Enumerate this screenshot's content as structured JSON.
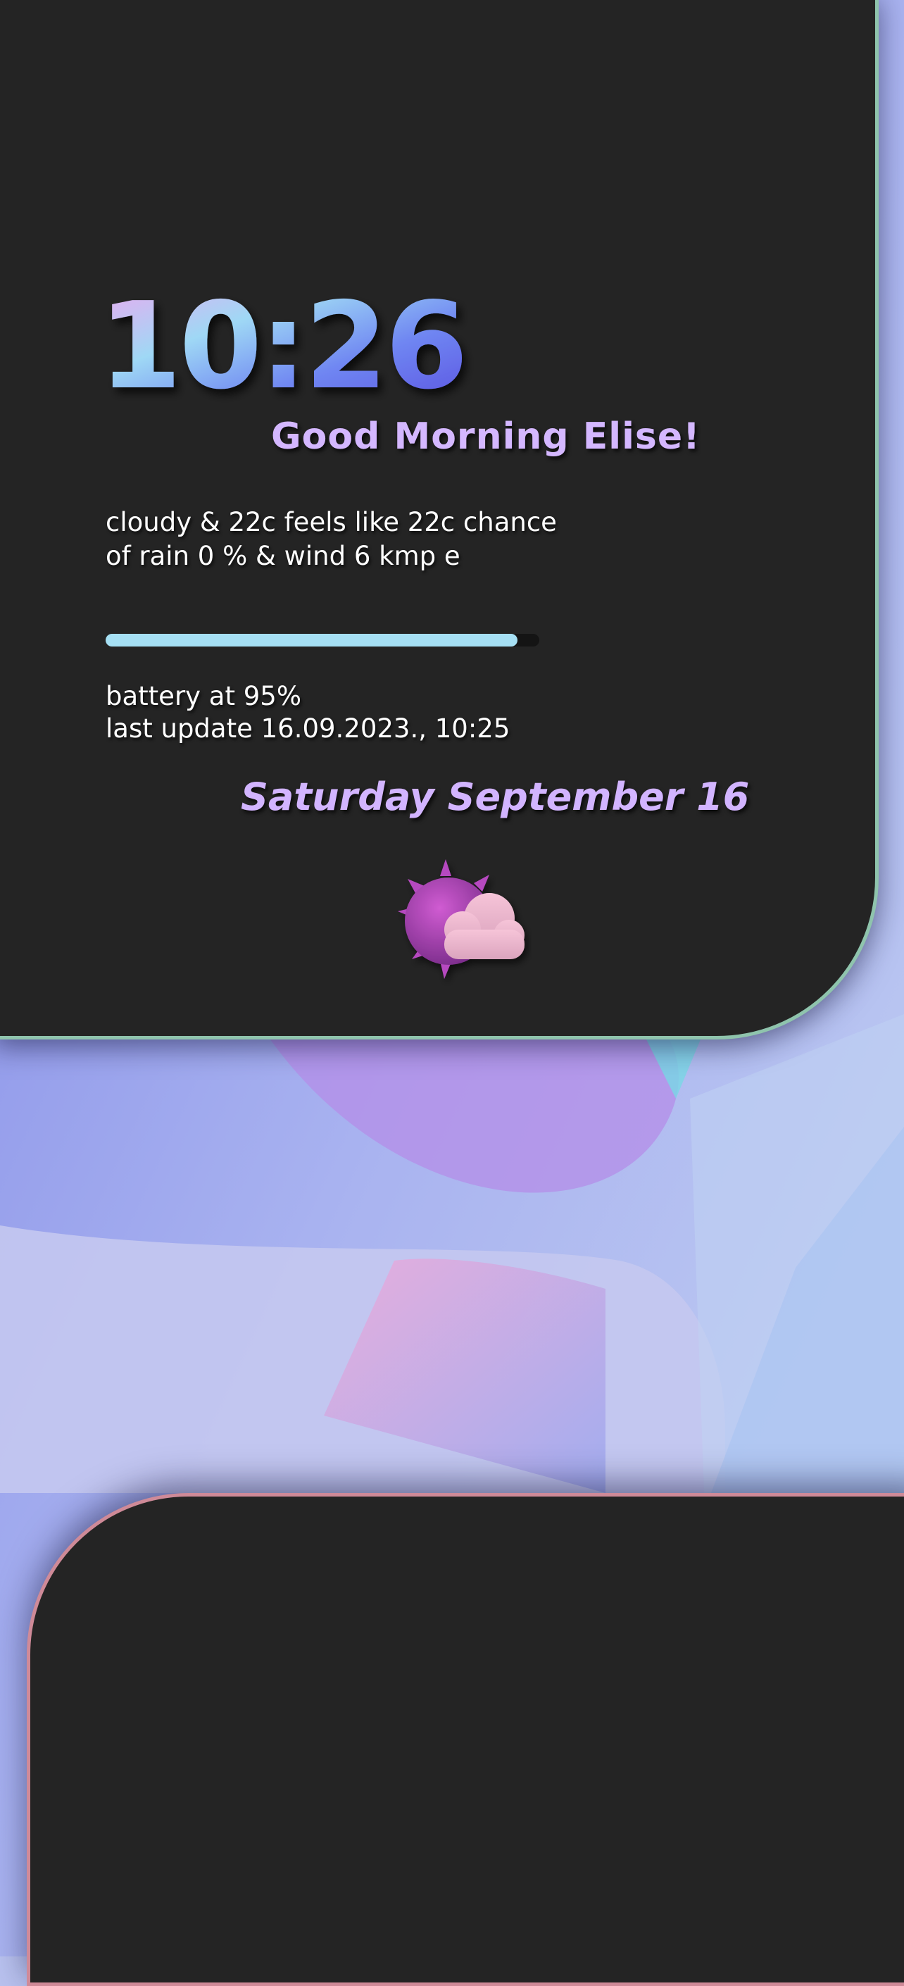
{
  "clock": {
    "time": "10:26"
  },
  "greeting": {
    "text": "Good Morning Elise!"
  },
  "weather": {
    "line1": "cloudy & 22c feels like 22c chance",
    "line2": "of rain 0 % & wind 6 kmp e",
    "icon": "partly-cloudy-icon"
  },
  "battery": {
    "level_percent": 95,
    "text": "battery at 95%",
    "last_update": "last update 16.09.2023., 10:25"
  },
  "date": {
    "text": "Saturday September 16"
  },
  "colors": {
    "card_background": "#242424",
    "top_card_border": "#8fc4ad",
    "bottom_card_border": "#cf8a98",
    "accent_text": "#d4b7ff",
    "battery_fill": "#a6e0f4",
    "battery_track": "#141414"
  }
}
